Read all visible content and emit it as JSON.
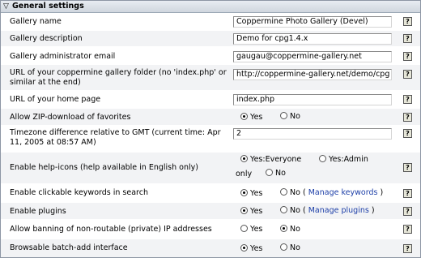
{
  "header": {
    "title": "General settings"
  },
  "rows": [
    {
      "label": "Gallery name",
      "value": "Coppermine Photo Gallery (Devel)"
    },
    {
      "label": "Gallery description",
      "value": "Demo for cpg1.4.x"
    },
    {
      "label": "Gallery administrator email",
      "value": "gaugau@coppermine-gallery.net"
    },
    {
      "label_line1": "URL of your coppermine gallery folder (no 'index.php' or",
      "label_line2": "similar at the end)",
      "value": "http://coppermine-gallery.net/demo/cpg"
    },
    {
      "label": "URL of your home page",
      "value": "index.php"
    },
    {
      "label": "Allow ZIP-download of favorites",
      "opt1": "Yes",
      "opt2": "No"
    },
    {
      "label_line1": "Timezone difference relative to GMT (current time: Apr",
      "label_line2": "11, 2005 at 08:57 AM)",
      "value": "2"
    },
    {
      "label": "Enable help-icons (help available in English only)",
      "opt1": "Yes:Everyone",
      "opt2": "Yes:Admin",
      "opt2_cont": "only",
      "opt3": "No"
    },
    {
      "label": "Enable clickable keywords in search",
      "opt1": "Yes",
      "opt2": "No",
      "link_open": "(",
      "link_text": "Manage keywords",
      "link_close": ")"
    },
    {
      "label": "Enable plugins",
      "opt1": "Yes",
      "opt2": "No",
      "link_open": "(",
      "link_text": "Manage plugins",
      "link_close": ")"
    },
    {
      "label": "Allow banning of non-routable (private) IP addresses",
      "opt1": "Yes",
      "opt2": "No"
    },
    {
      "label": "Browsable batch-add interface",
      "opt1": "Yes",
      "opt2": "No"
    }
  ],
  "help_glyph": "?",
  "icons": {
    "collapse": "triangle-down-icon",
    "help": "help-icon"
  },
  "colors": {
    "header_bg": "#d9dee5",
    "alt_row_bg": "#f2f3f5",
    "link": "#1d3fa8"
  }
}
